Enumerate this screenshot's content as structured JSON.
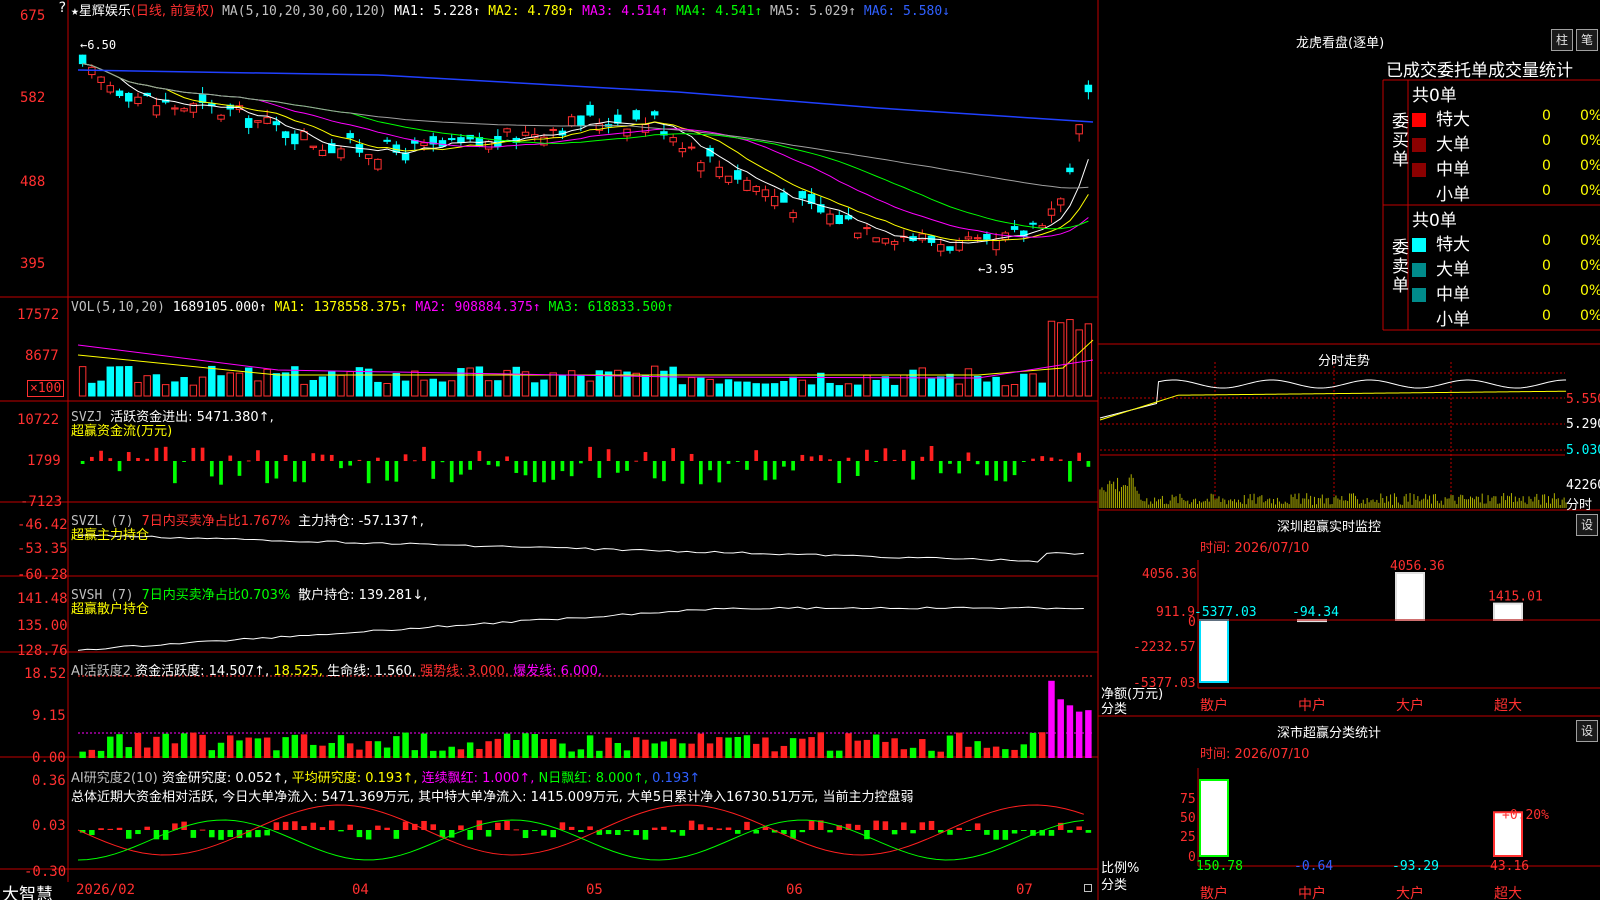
{
  "stock": {
    "name": "星辉娱乐",
    "mode": "(日线, 前复权)",
    "star": "★"
  },
  "main_chart": {
    "ma_label": "MA(5,10,20,30,60,120)",
    "ma1": "MA1: 5.228↑",
    "ma2": "MA2: 4.789↑",
    "ma3": "MA3: 4.514↑",
    "ma4": "MA4: 4.541↑",
    "ma5": "MA5: 5.029↑",
    "ma6": "MA6: 5.580↓",
    "y_ticks": [
      "675",
      "582",
      "488",
      "395"
    ],
    "high_marker": "←6.50",
    "low_marker": "←3.95"
  },
  "vol_panel": {
    "header_label": "VOL(5,10,20)",
    "value": "1689105.000↑",
    "ma1": "MA1: 1378558.375↑",
    "ma2": "MA2: 908884.375↑",
    "ma3": "MA3: 618833.500↑",
    "y_ticks": [
      "17572",
      "8677"
    ],
    "unit": "×100"
  },
  "svzj_panel": {
    "label": "SVZJ",
    "desc": "活跃资金进出: 5471.380↑,",
    "subtitle": "超赢资金流(万元)",
    "y_ticks": [
      "10722",
      "1799",
      "-7123"
    ]
  },
  "svzl_panel": {
    "label": "SVZL (7)",
    "desc": "7日内买卖净占比1.767%",
    "value": "主力持仓: -57.137↑,",
    "subtitle": "超赢主力持仓",
    "y_ticks": [
      "-46.42",
      "-53.35",
      "-60.28"
    ]
  },
  "svsh_panel": {
    "label": "SVSH (7)",
    "desc": "7日内买卖净占比0.703%",
    "value": "散户持仓: 139.281↓,",
    "subtitle": "超赢散户持仓",
    "y_ticks": [
      "141.48",
      "135.00",
      "128.76"
    ]
  },
  "ai_active_panel": {
    "label": "AI活跃度2",
    "v1": "资金活跃度: 14.507↑,",
    "v2": "18.525,",
    "v3": "生命线: 1.560,",
    "v4": "强势线: 3.000,",
    "v5": "爆发线: 6.000,",
    "y_ticks": [
      "18.52",
      "9.15",
      "0.00"
    ]
  },
  "ai_research_panel": {
    "label": "AI研究度2(10)",
    "v1": "资金研究度: 0.052↑,",
    "v2": "平均研究度: 0.193↑,",
    "v3": "连续飘红: 1.000↑,",
    "v4": "N日飘红: 8.000↑,",
    "v5": "0.193↑",
    "summary": "总体近期大资金相对活跃, 今日大单净流入: 5471.369万元, 其中特大单净流入: 1415.009万元, 大单5日累计净入16730.51万元, 当前主力控盘弱",
    "y_ticks": [
      "0.36",
      "0.03",
      "-0.30"
    ]
  },
  "x_axis": {
    "labels": [
      "2026/02",
      "04",
      "05",
      "06",
      "07"
    ]
  },
  "brand": "大智慧",
  "lhb": {
    "title": "龙虎看盘(逐单)",
    "btn_bar": "柱",
    "btn_bi": "笔",
    "tabs": [
      "已成交",
      "委托单",
      "成交量统计"
    ],
    "buy_label": "委买单",
    "sell_label": "委卖单",
    "buy_total": "共0单",
    "sell_total": "共0单",
    "rows": [
      {
        "name": "特大",
        "count": "0",
        "pct": "0%"
      },
      {
        "name": "大单",
        "count": "0",
        "pct": "0%"
      },
      {
        "name": "中单",
        "count": "0",
        "pct": "0%"
      },
      {
        "name": "小单",
        "count": "0",
        "pct": "0%"
      }
    ],
    "buy_colors": [
      "#ff0000",
      "#8b0000",
      "#8b0000",
      "#000000"
    ],
    "sell_colors": [
      "#00ffff",
      "#008b8b",
      "#008b8b",
      "#000000"
    ]
  },
  "intraday": {
    "title": "分时走势",
    "y_ticks": [
      "5.550",
      "5.290",
      "5.030"
    ],
    "vol_tick": "42260",
    "vol_unit": "分时"
  },
  "sz_monitor": {
    "title": "深圳超赢实时监控",
    "btn": "设",
    "time": "时间: 2026/07/10",
    "y_ticks": [
      "4056.36",
      "911.9",
      "0",
      "-2232.57",
      "-5377.03"
    ],
    "y_unit": "净额(万元)",
    "x_unit": "分类",
    "categories": [
      "散户",
      "中户",
      "大户",
      "超大"
    ],
    "values": [
      -5377.03,
      -94.34,
      4056.36,
      1415.01
    ],
    "value_labels": [
      "-5377.03",
      "-94.34",
      "4056.36",
      "1415.01"
    ]
  },
  "sz_class": {
    "title": "深市超赢分类统计",
    "btn": "设",
    "time": "时间: 2026/07/10",
    "y_ticks": [
      "75",
      "50",
      "25",
      "0"
    ],
    "y_unit": "比例%",
    "x_unit": "分类",
    "categories": [
      "散户",
      "中户",
      "大户",
      "超大"
    ],
    "values": [
      150.78,
      -0.64,
      -93.29,
      43.16
    ],
    "value_labels": [
      "150.78",
      "-0.64",
      "-93.29",
      "43.16"
    ],
    "extra_label": "+0.20%"
  },
  "chart_data": [
    {
      "type": "bar",
      "title": "深圳超赢实时监控",
      "categories": [
        "散户",
        "中户",
        "大户",
        "超大"
      ],
      "series": [
        {
          "values": [
            -5377.03,
            -94.34,
            4056.36,
            1415.01
          ]
        }
      ],
      "ylabel": "净额(万元)",
      "xlabel": "分类",
      "ylim": [
        -5377.03,
        4056.36
      ]
    },
    {
      "type": "bar",
      "title": "深市超赢分类统计",
      "categories": [
        "散户",
        "中户",
        "大户",
        "超大"
      ],
      "series": [
        {
          "values": [
            150.78,
            -0.64,
            -93.29,
            43.16
          ]
        }
      ],
      "ylabel": "比例%",
      "xlabel": "分类",
      "ylim": [
        0,
        75
      ]
    }
  ]
}
